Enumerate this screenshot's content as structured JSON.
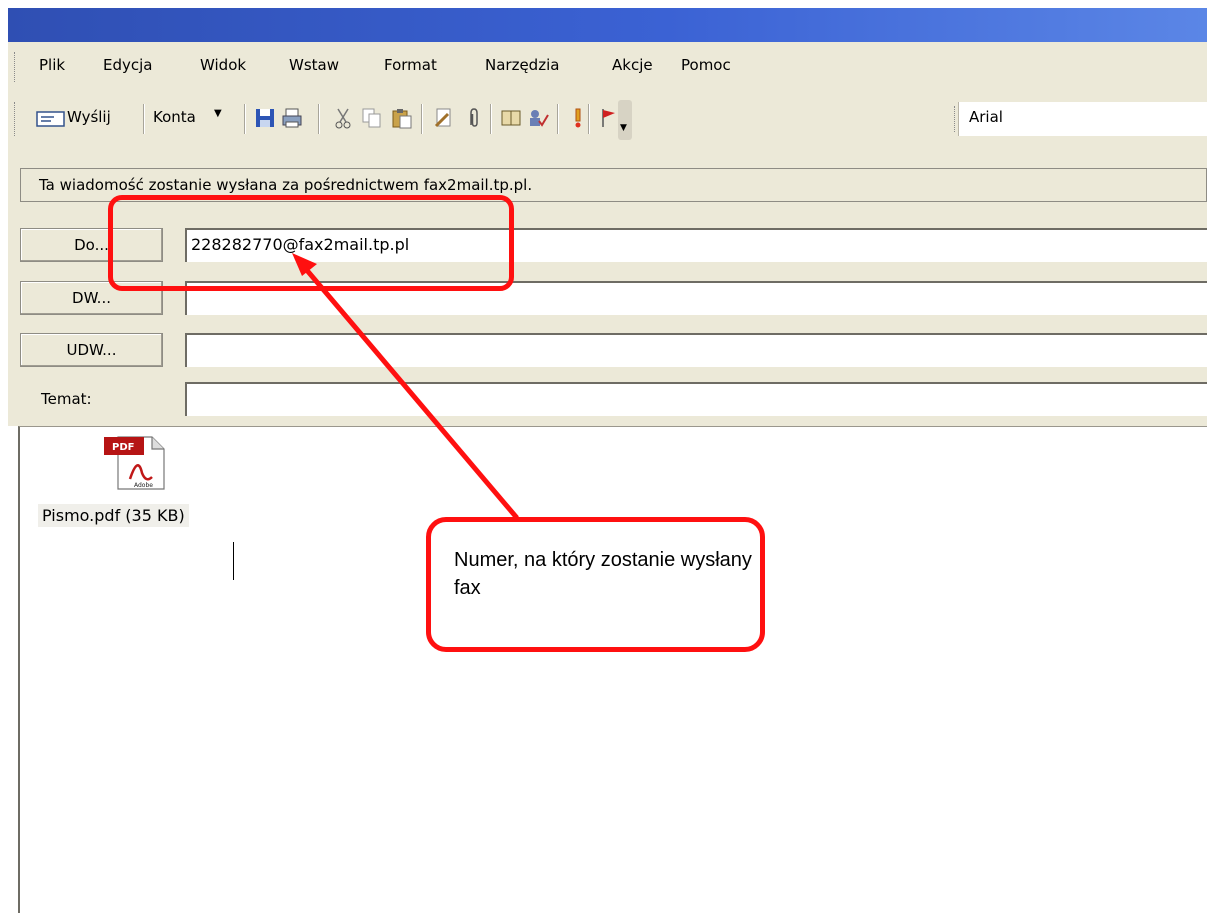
{
  "menubar": {
    "items": [
      "Plik",
      "Edycja",
      "Widok",
      "Wstaw",
      "Format",
      "Narzędzia",
      "Akcje",
      "Pomoc"
    ]
  },
  "toolbar": {
    "send_label": "Wyślij",
    "accounts_label": "Konta",
    "font_name": "Arial",
    "icons": [
      "send-icon",
      "save-icon",
      "print-icon",
      "cut-icon",
      "copy-icon",
      "paste-icon",
      "insert-file-icon",
      "attach-icon",
      "address-book-icon",
      "check-names-icon",
      "importance-icon",
      "flag-icon",
      "toolbar-options-icon"
    ]
  },
  "infobar": {
    "text": "Ta wiadomość zostanie wysłana za pośrednictwem fax2mail.tp.pl."
  },
  "fields": {
    "to_button": "Do...",
    "to_value": "228282770@fax2mail.tp.pl",
    "cc_button": "DW...",
    "cc_value": "",
    "bcc_button": "UDW...",
    "bcc_value": "",
    "subject_label": "Temat:",
    "subject_value": ""
  },
  "attachment": {
    "name": "Pismo.pdf (35 KB)",
    "icon": "pdf-icon",
    "icon_badge": "PDF",
    "icon_brand": "Adobe"
  },
  "annotation": {
    "callout_text": "Numer, na który zostanie wysłany fax",
    "color": "#ff1010"
  },
  "colors": {
    "title_bar": "#3b62d4",
    "chrome": "#ece9d8"
  }
}
